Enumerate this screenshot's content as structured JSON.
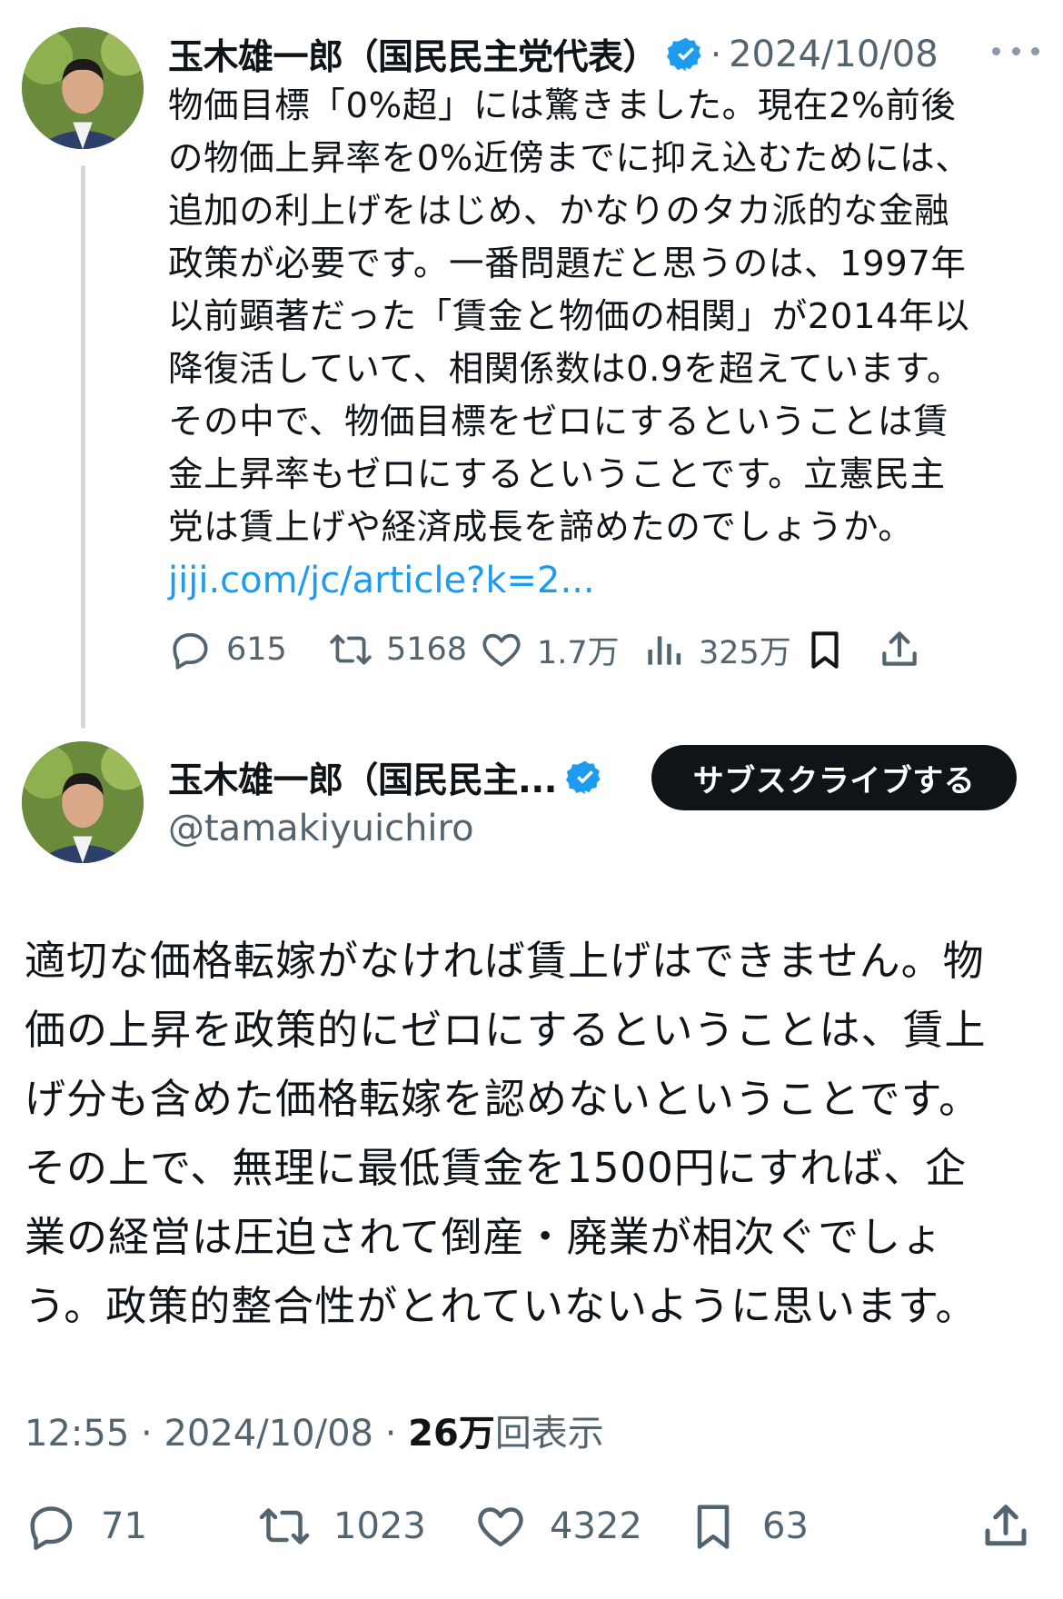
{
  "parent_tweet": {
    "author_name": "玉木雄一郎（国民民主党代表）",
    "separator": "·",
    "date": "2024/10/08",
    "text_lines": [
      "物価目標「0%超」には驚きました。現在2%前後",
      "の物価上昇率を0%近傍までに抑え込むためには、",
      "追加の利上げをはじめ、かなりのタカ派的な金融",
      "政策が必要です。一番問題だと思うのは、1997年",
      "以前顕著だった「賃金と物価の相関」が2014年以",
      "降復活していて、相関係数は0.9を超えています。",
      "その中で、物価目標をゼロにするということは賃",
      "金上昇率もゼロにするということです。立憲民主",
      "党は賃上げや経済成長を諦めたのでしょうか。"
    ],
    "link": "jiji.com/jc/article?k=2...",
    "replies": "615",
    "retweets": "5168",
    "likes": "1.7万",
    "views": "325万"
  },
  "main_tweet": {
    "author_name": "玉木雄一郎（国民民主...",
    "handle": "@tamakiyuichiro",
    "subscribe_label": "サブスクライブする",
    "text_lines": [
      "適切な価格転嫁がなければ賃上げはできません。物",
      "価の上昇を政策的にゼロにするということは、賃上",
      "げ分も含めた価格転嫁を認めないということです。",
      "その上で、無理に最低賃金を1500円にすれば、企",
      "業の経営は圧迫されて倒産・廃業が相次ぐでしょ",
      "う。政策的整合性がとれていないように思います。"
    ],
    "time": "12:55",
    "date": "2024/10/08",
    "separator": " · ",
    "view_count": "26万",
    "view_suffix": "回表示",
    "replies": "71",
    "retweets": "1023",
    "likes": "4322",
    "bookmarks": "63"
  },
  "icons": {
    "verified": "verified-badge-icon",
    "more": "more-icon",
    "reply": "reply-icon",
    "retweet": "retweet-icon",
    "like": "heart-icon",
    "views": "views-icon",
    "bookmark": "bookmark-icon",
    "share": "share-icon"
  },
  "colors": {
    "link": "#1d9bf0",
    "secondary_text": "#536471",
    "verified": "#1d9bf0",
    "subscribe_bg": "#0f1419"
  }
}
